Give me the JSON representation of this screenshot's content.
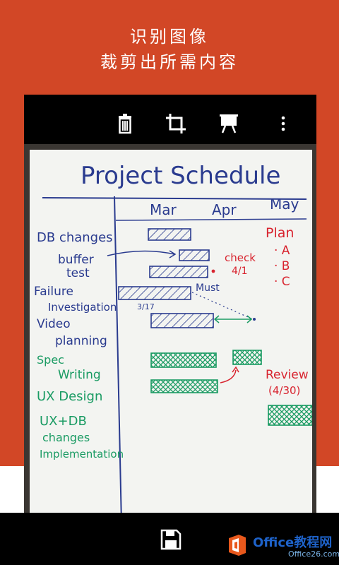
{
  "headline": {
    "line1": "识别图像",
    "line2": "裁剪出所需内容"
  },
  "toolbar": {
    "icons": [
      "trash-icon",
      "crop-icon",
      "whiteboard-icon",
      "more-vertical-icon"
    ]
  },
  "board": {
    "title": "Project Schedule",
    "months": [
      "Mar",
      "Apr",
      "May"
    ],
    "tasks": [
      "DB changes",
      "buffer",
      "test",
      "Failure",
      "Investigation",
      "Video",
      "planning",
      "Spec",
      "Writing",
      "UX Design",
      "UX+DB",
      "changes",
      "Implementation"
    ],
    "notes": {
      "plan": "Plan",
      "plan_items": [
        "· A",
        "· B",
        "· C"
      ],
      "check": "check",
      "check_date": "4/1",
      "must": "Must",
      "date317": "3/17",
      "review": "Review",
      "review_date": "(4/30)"
    }
  },
  "bottom": {
    "icon": "save-icon"
  },
  "watermark": {
    "brand": "Office教程网",
    "sub": "Office26.com"
  },
  "colors": {
    "accent": "#d24726",
    "marker_blue": "#2a3b8f",
    "marker_red": "#d8242f",
    "marker_green": "#1a9b63"
  }
}
